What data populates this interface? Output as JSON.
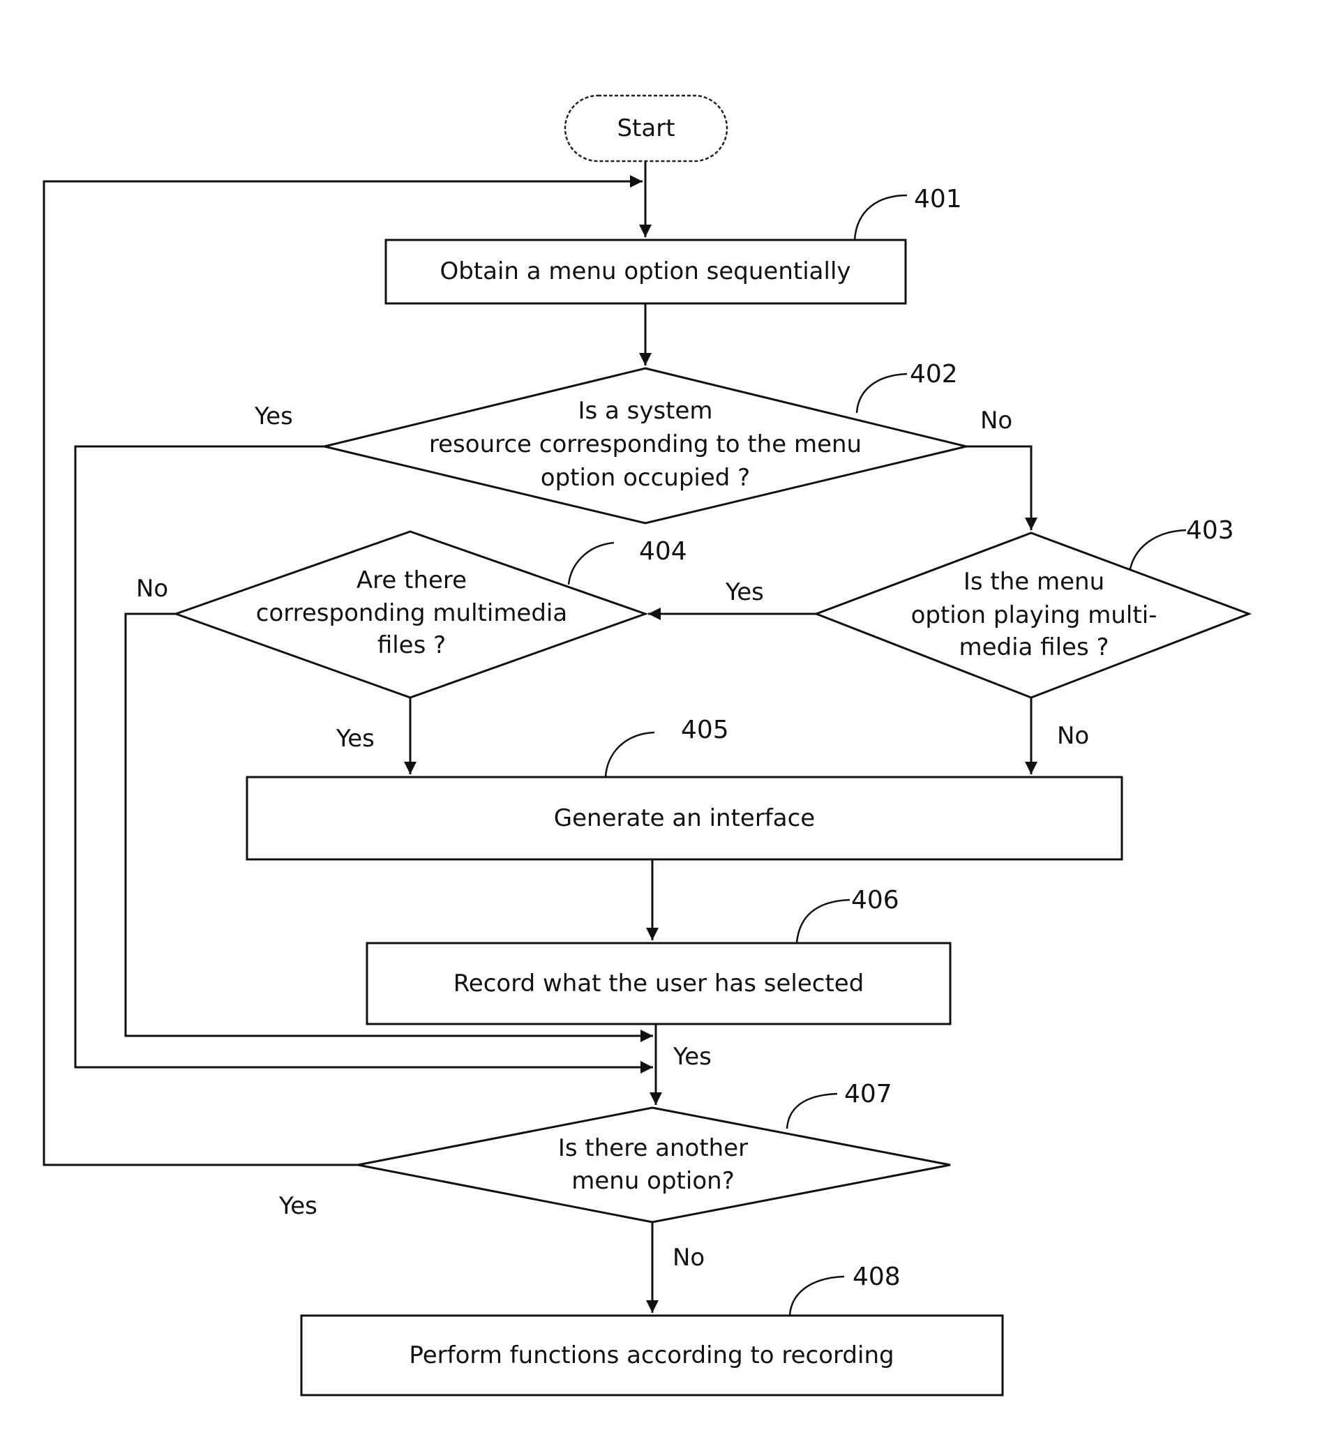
{
  "diagram": {
    "type": "flowchart",
    "nodes": [
      {
        "id": "start",
        "shape": "terminal",
        "lines": [
          "Start"
        ],
        "ref": ""
      },
      {
        "id": "401",
        "shape": "process",
        "lines": [
          "Obtain a menu option sequentially"
        ],
        "ref": "401"
      },
      {
        "id": "402",
        "shape": "decision",
        "lines": [
          "Is a system",
          "resource corresponding to the menu",
          "option occupied ?"
        ],
        "ref": "402"
      },
      {
        "id": "403",
        "shape": "decision",
        "lines": [
          "Is the menu",
          "option playing multi-",
          "media files ?"
        ],
        "ref": "403"
      },
      {
        "id": "404",
        "shape": "decision",
        "lines": [
          "Are there",
          "corresponding multimedia",
          "files ?"
        ],
        "ref": "404"
      },
      {
        "id": "405",
        "shape": "process",
        "lines": [
          "Generate an interface"
        ],
        "ref": "405"
      },
      {
        "id": "406",
        "shape": "process",
        "lines": [
          "Record what the user has selected"
        ],
        "ref": "406"
      },
      {
        "id": "407",
        "shape": "decision",
        "lines": [
          "Is there another",
          "menu option?"
        ],
        "ref": "407"
      },
      {
        "id": "408",
        "shape": "process",
        "lines": [
          "Perform functions according to recording"
        ],
        "ref": "408"
      }
    ],
    "edges": [
      {
        "from": "start",
        "to": "401",
        "label": ""
      },
      {
        "from": "401",
        "to": "402",
        "label": ""
      },
      {
        "from": "402",
        "to": "407",
        "label": "Yes"
      },
      {
        "from": "402",
        "to": "403",
        "label": "No"
      },
      {
        "from": "403",
        "to": "404",
        "label": "Yes"
      },
      {
        "from": "403",
        "to": "405",
        "label": "No"
      },
      {
        "from": "404",
        "to": "405",
        "label": "Yes"
      },
      {
        "from": "404",
        "to": "407",
        "label": "No"
      },
      {
        "from": "405",
        "to": "406",
        "label": ""
      },
      {
        "from": "406",
        "to": "407",
        "label": "Yes"
      },
      {
        "from": "407",
        "to": "401",
        "label": "Yes"
      },
      {
        "from": "407",
        "to": "408",
        "label": "No"
      }
    ]
  }
}
